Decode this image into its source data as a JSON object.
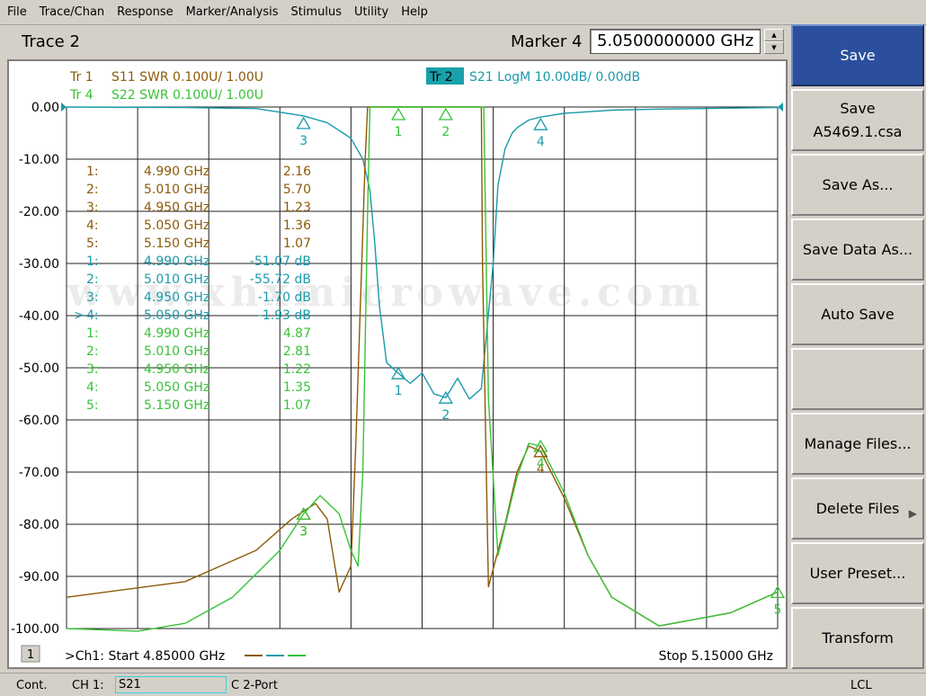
{
  "menubar": {
    "items": [
      "File",
      "Trace/Chan",
      "Response",
      "Marker/Analysis",
      "Stimulus",
      "Utility",
      "Help"
    ]
  },
  "header": {
    "trace_title": "Trace 2",
    "marker_title": "Marker 4",
    "marker_value": "5.0500000000 GHz"
  },
  "colors": {
    "s11": "#8c5a08",
    "s21": "#1a9aaa",
    "s22": "#38c238",
    "grid": "#202020",
    "active_softkey": "#2b4f9c",
    "active_tab": "#1aa0a8"
  },
  "trace_legend": {
    "tr1": {
      "tr": "Tr 1",
      "text": "S11 SWR 0.100U/  1.00U"
    },
    "tr4": {
      "tr": "Tr 4",
      "text": "S22 SWR 0.100U/  1.00U"
    },
    "tr2": {
      "tr": "Tr 2",
      "text": "S21 LogM 10.00dB/  0.00dB"
    }
  },
  "y_tick_labels": [
    "0.00",
    "-10.00",
    "-20.00",
    "-30.00",
    "-40.00",
    "-50.00",
    "-60.00",
    "-70.00",
    "-80.00",
    "-90.00",
    "-100.00"
  ],
  "marker_table": [
    {
      "prefix": "",
      "n": "1:",
      "freq": "4.990 GHz",
      "val": "2.16",
      "trace": "s11"
    },
    {
      "prefix": "",
      "n": "2:",
      "freq": "5.010 GHz",
      "val": "5.70",
      "trace": "s11"
    },
    {
      "prefix": "",
      "n": "3:",
      "freq": "4.950 GHz",
      "val": "1.23",
      "trace": "s11"
    },
    {
      "prefix": "",
      "n": "4:",
      "freq": "5.050 GHz",
      "val": "1.36",
      "trace": "s11"
    },
    {
      "prefix": "",
      "n": "5:",
      "freq": "5.150 GHz",
      "val": "1.07",
      "trace": "s11"
    },
    {
      "prefix": "",
      "n": "1:",
      "freq": "4.990 GHz",
      "val": "-51.07 dB",
      "trace": "s21"
    },
    {
      "prefix": "",
      "n": "2:",
      "freq": "5.010 GHz",
      "val": "-55.72 dB",
      "trace": "s21"
    },
    {
      "prefix": "",
      "n": "3:",
      "freq": "4.950 GHz",
      "val": "-1.70 dB",
      "trace": "s21"
    },
    {
      "prefix": ">",
      "n": "4:",
      "freq": "5.050 GHz",
      "val": "-1.93 dB",
      "trace": "s21"
    },
    {
      "prefix": "",
      "n": "1:",
      "freq": "4.990 GHz",
      "val": "4.87",
      "trace": "s22"
    },
    {
      "prefix": "",
      "n": "2:",
      "freq": "5.010 GHz",
      "val": "2.81",
      "trace": "s22"
    },
    {
      "prefix": "",
      "n": "3:",
      "freq": "4.950 GHz",
      "val": "1.22",
      "trace": "s22"
    },
    {
      "prefix": "",
      "n": "4:",
      "freq": "5.050 GHz",
      "val": "1.35",
      "trace": "s22"
    },
    {
      "prefix": "",
      "n": "5:",
      "freq": "5.150 GHz",
      "val": "1.07",
      "trace": "s22"
    }
  ],
  "watermark": "www.xhxmicrowave.com",
  "channel_badge": "1",
  "start_label": ">Ch1: Start  4.85000 GHz",
  "stop_label": "Stop  5.15000 GHz",
  "chart_data": {
    "type": "line",
    "xlim": [
      4.85,
      5.15
    ],
    "ylim": [
      -100,
      0
    ],
    "grid": true,
    "series": [
      {
        "name": "S21",
        "x": [
          4.85,
          4.9,
          4.93,
          4.95,
          4.96,
          4.97,
          4.975,
          4.978,
          4.98,
          4.982,
          4.985,
          4.99,
          4.995,
          5.0,
          5.005,
          5.01,
          5.015,
          5.02,
          5.025,
          5.03,
          5.032,
          5.035,
          5.038,
          5.04,
          5.045,
          5.05,
          5.06,
          5.08,
          5.1,
          5.15
        ],
        "y": [
          0,
          -0.1,
          -0.3,
          -1.7,
          -3,
          -6,
          -10,
          -16,
          -26,
          -38,
          -49,
          -51.07,
          -53,
          -51,
          -55,
          -55.72,
          -52,
          -56,
          -54,
          -30,
          -15,
          -8,
          -5,
          -4,
          -2.5,
          -1.93,
          -1.2,
          -0.6,
          -0.4,
          -0.1
        ]
      },
      {
        "name": "S11",
        "x": [
          4.85,
          4.9,
          4.93,
          4.945,
          4.955,
          4.96,
          4.965,
          4.97,
          4.972,
          4.976,
          4.977,
          4.978,
          5.025,
          5.0255,
          5.028,
          5.035,
          5.04,
          5.045,
          5.05,
          5.06,
          5.07,
          5.08,
          5.1,
          5.13,
          5.15
        ],
        "y": [
          -94,
          -91,
          -85,
          -79,
          -76,
          -79,
          -93,
          -88,
          -65,
          -10,
          0,
          0,
          0,
          -30,
          -92,
          -80,
          -70,
          -65,
          -66,
          -75,
          -86,
          -94,
          -99.5,
          -97,
          -93
        ]
      },
      {
        "name": "S22",
        "x": [
          4.85,
          4.88,
          4.9,
          4.92,
          4.94,
          4.95,
          4.957,
          4.965,
          4.97,
          4.973,
          4.975,
          4.977,
          4.978,
          5.026,
          5.028,
          5.032,
          5.04,
          5.045,
          5.05,
          5.06,
          5.07,
          5.08,
          5.1,
          5.13,
          5.15
        ],
        "y": [
          -100,
          -100.5,
          -99,
          -94,
          -85,
          -78,
          -74.5,
          -78,
          -85,
          -88,
          -70,
          -20,
          0,
          0,
          -56,
          -86,
          -71,
          -64.5,
          -65,
          -74,
          -86,
          -94,
          -99.5,
          -97,
          -93
        ]
      }
    ],
    "markers": [
      {
        "trace": "S21",
        "id": "1",
        "x": 4.99,
        "y": -51.07
      },
      {
        "trace": "S21",
        "id": "2",
        "x": 5.01,
        "y": -55.72
      },
      {
        "trace": "S21",
        "id": "3",
        "x": 4.95,
        "y": -1.7
      },
      {
        "trace": "S21",
        "id": "4",
        "x": 5.05,
        "y": -1.93
      },
      {
        "trace": "S11",
        "id": "3",
        "x": 4.95,
        "y": -78
      },
      {
        "trace": "S11",
        "id": "4",
        "x": 5.05,
        "y": -66
      },
      {
        "trace": "S22",
        "id": "1",
        "x": 4.99,
        "y": 0
      },
      {
        "trace": "S22",
        "id": "2",
        "x": 5.01,
        "y": 0
      },
      {
        "trace": "S22",
        "id": "3",
        "x": 4.95,
        "y": -78
      },
      {
        "trace": "S22",
        "id": "4",
        "x": 5.05,
        "y": -65
      },
      {
        "trace": "S22",
        "id": "5",
        "x": 5.15,
        "y": -93
      }
    ]
  },
  "softkeys": [
    {
      "label": "Save",
      "active": true,
      "arrow": false
    },
    {
      "label": "Save\nA5469.1.csa",
      "active": false,
      "arrow": false
    },
    {
      "label": "Save As...",
      "active": false,
      "arrow": false
    },
    {
      "label": "Save Data As...",
      "active": false,
      "arrow": false
    },
    {
      "label": "Auto Save",
      "active": false,
      "arrow": false
    },
    {
      "label": "",
      "active": false,
      "arrow": false
    },
    {
      "label": "Manage Files...",
      "active": false,
      "arrow": false
    },
    {
      "label": "Delete Files",
      "active": false,
      "arrow": true
    },
    {
      "label": "User Preset...",
      "active": false,
      "arrow": false
    },
    {
      "label": "Transform",
      "active": false,
      "arrow": false
    }
  ],
  "statusbar": {
    "cont": "Cont.",
    "ch": "CH 1:",
    "meas": "S21",
    "cal": "C  2-Port",
    "lcl": "LCL"
  }
}
